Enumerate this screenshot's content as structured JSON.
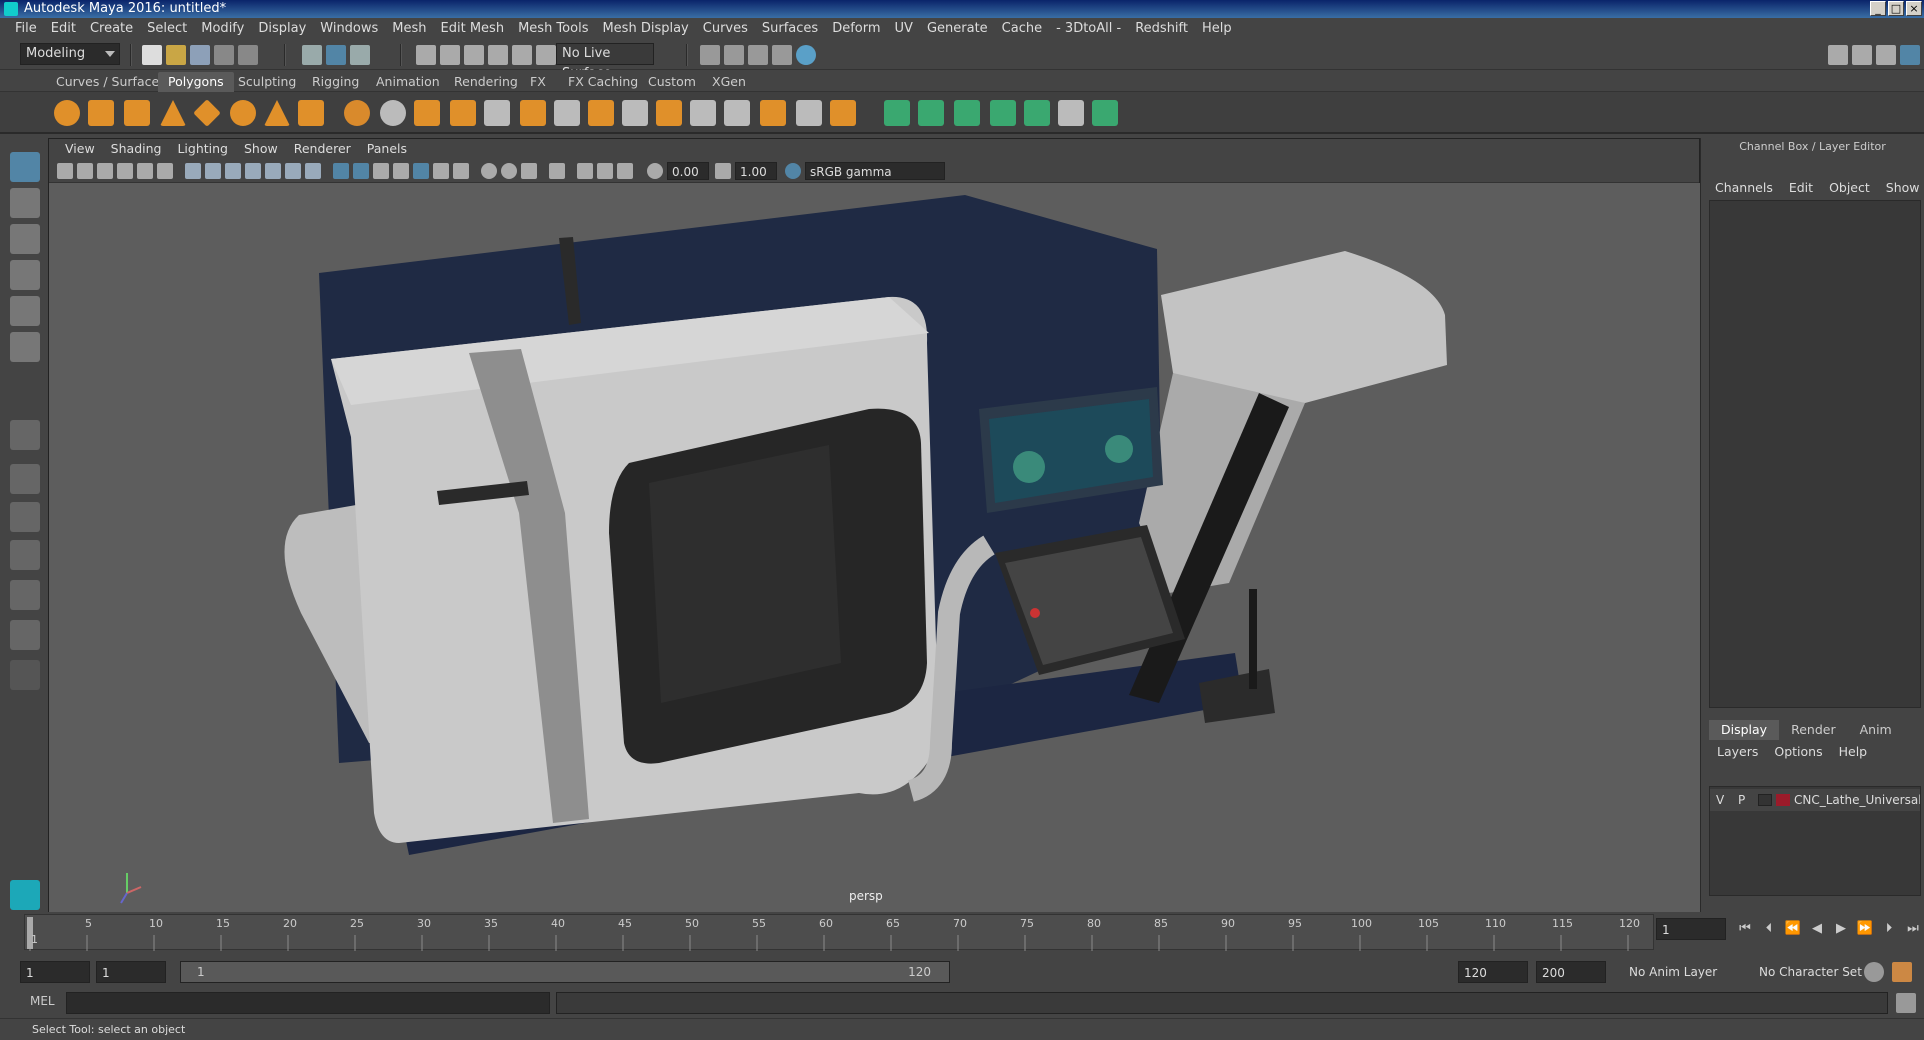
{
  "window": {
    "title": "Autodesk Maya 2016: untitled*"
  },
  "menu": [
    "File",
    "Edit",
    "Create",
    "Select",
    "Modify",
    "Display",
    "Windows",
    "Mesh",
    "Edit Mesh",
    "Mesh Tools",
    "Mesh Display",
    "Curves",
    "Surfaces",
    "Deform",
    "UV",
    "Generate",
    "Cache",
    "- 3DtoAll -",
    "Redshift",
    "Help"
  ],
  "status": {
    "mode": "Modeling",
    "live_surface": "No Live Surface"
  },
  "shelf_tabs": [
    "Curves / Surfaces",
    "Polygons",
    "Sculpting",
    "Rigging",
    "Animation",
    "Rendering",
    "FX",
    "FX Caching",
    "Custom",
    "XGen"
  ],
  "shelf_active": "Polygons",
  "viewport": {
    "menu": [
      "View",
      "Shading",
      "Lighting",
      "Show",
      "Renderer",
      "Panels"
    ],
    "exposure": "0.00",
    "gamma": "1.00",
    "color_space": "sRGB gamma",
    "camera": "persp"
  },
  "channel_box": {
    "title": "Channel Box / Layer Editor",
    "menu": [
      "Channels",
      "Edit",
      "Object",
      "Show"
    ],
    "layer_tabs": [
      "Display",
      "Render",
      "Anim"
    ],
    "layer_active": "Display",
    "layer_menu": [
      "Layers",
      "Options",
      "Help"
    ],
    "layer": {
      "v": "V",
      "p": "P",
      "name": "CNC_Lathe_Universal_",
      "color": "#9b1b2a"
    }
  },
  "timeline": {
    "ticks": [
      "1",
      "5",
      "10",
      "15",
      "20",
      "25",
      "30",
      "35",
      "40",
      "45",
      "50",
      "55",
      "60",
      "65",
      "70",
      "75",
      "80",
      "85",
      "90",
      "95",
      "100",
      "105",
      "110",
      "115",
      "120"
    ],
    "current_frame": "1"
  },
  "range": {
    "start": "1",
    "playback_start": "1",
    "slider_start": "1",
    "slider_end": "120",
    "playback_end": "120",
    "end": "200",
    "anim_layer": "No Anim Layer",
    "char_set": "No Character Set"
  },
  "cmd": {
    "lang": "MEL"
  },
  "help": {
    "text": "Select Tool: select an object"
  },
  "colors": {
    "accent": "#5285a6",
    "shelf_orange": "#e0902a",
    "green": "#3aa870"
  }
}
